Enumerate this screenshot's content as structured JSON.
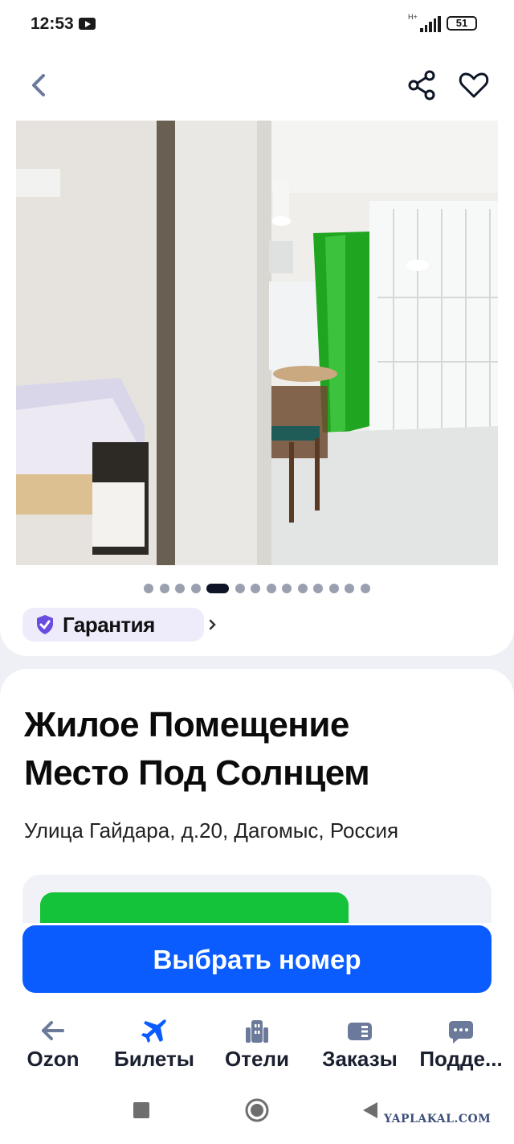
{
  "status_bar": {
    "time": "12:53",
    "network": "H+",
    "battery": "51"
  },
  "header": {
    "back_icon": "chevron-left-icon",
    "share_icon": "share-icon",
    "favorite_icon": "heart-icon"
  },
  "gallery": {
    "photo_count": 14,
    "active_index": 4
  },
  "guarantee": {
    "label": "Гарантия"
  },
  "hotel": {
    "title_line1": "Жилое Помещение",
    "title_line2": "Место Под Солнцем",
    "address": "Улица Гайдара, д.20, Дагомыс, Россия"
  },
  "actions": {
    "select_room_label": "Выбрать номер"
  },
  "tabbar": {
    "items": [
      {
        "label": "Ozon",
        "icon": "arrow-left-icon"
      },
      {
        "label": "Билеты",
        "icon": "airplane-icon"
      },
      {
        "label": "Отели",
        "icon": "hotel-icon"
      },
      {
        "label": "Заказы",
        "icon": "orders-icon"
      },
      {
        "label": "Подде...",
        "icon": "chat-icon"
      }
    ],
    "active_index": 1,
    "active_color": "#0a5cff",
    "inactive_color": "#6b7a9a"
  },
  "watermark": "YAPLAKAL.COM",
  "colors": {
    "accent": "#0a5cff",
    "price_green": "#15c33a",
    "guarantee_bg": "#eeecfb",
    "guarantee_icon": "#6a4ce0"
  }
}
